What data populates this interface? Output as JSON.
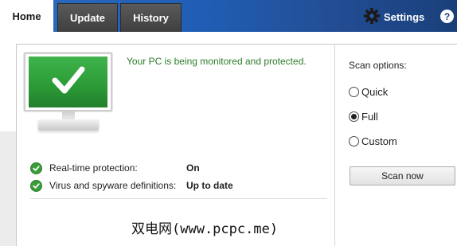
{
  "tabs": {
    "home": "Home",
    "update": "Update",
    "history": "History"
  },
  "header": {
    "settings_label": "Settings",
    "help_label": "?"
  },
  "icons": {
    "settings": "gear-icon",
    "help": "help-icon",
    "status": "check-circle-icon",
    "monitor": "monitor-check-icon"
  },
  "colors": {
    "top_bar": "#1f5eb4",
    "status_green": "#2a7d2a",
    "screen_green": "#2b9a36"
  },
  "status": {
    "message": "Your PC is being monitored and protected.",
    "rows": [
      {
        "label": "Real-time protection:",
        "value": "On"
      },
      {
        "label": "Virus and spyware definitions:",
        "value": "Up to date"
      }
    ]
  },
  "scan": {
    "title": "Scan options:",
    "options": [
      "Quick",
      "Full",
      "Custom"
    ],
    "selected": "Full",
    "button_label": "Scan now"
  },
  "watermark": "双电网(www.pcpc.me)"
}
